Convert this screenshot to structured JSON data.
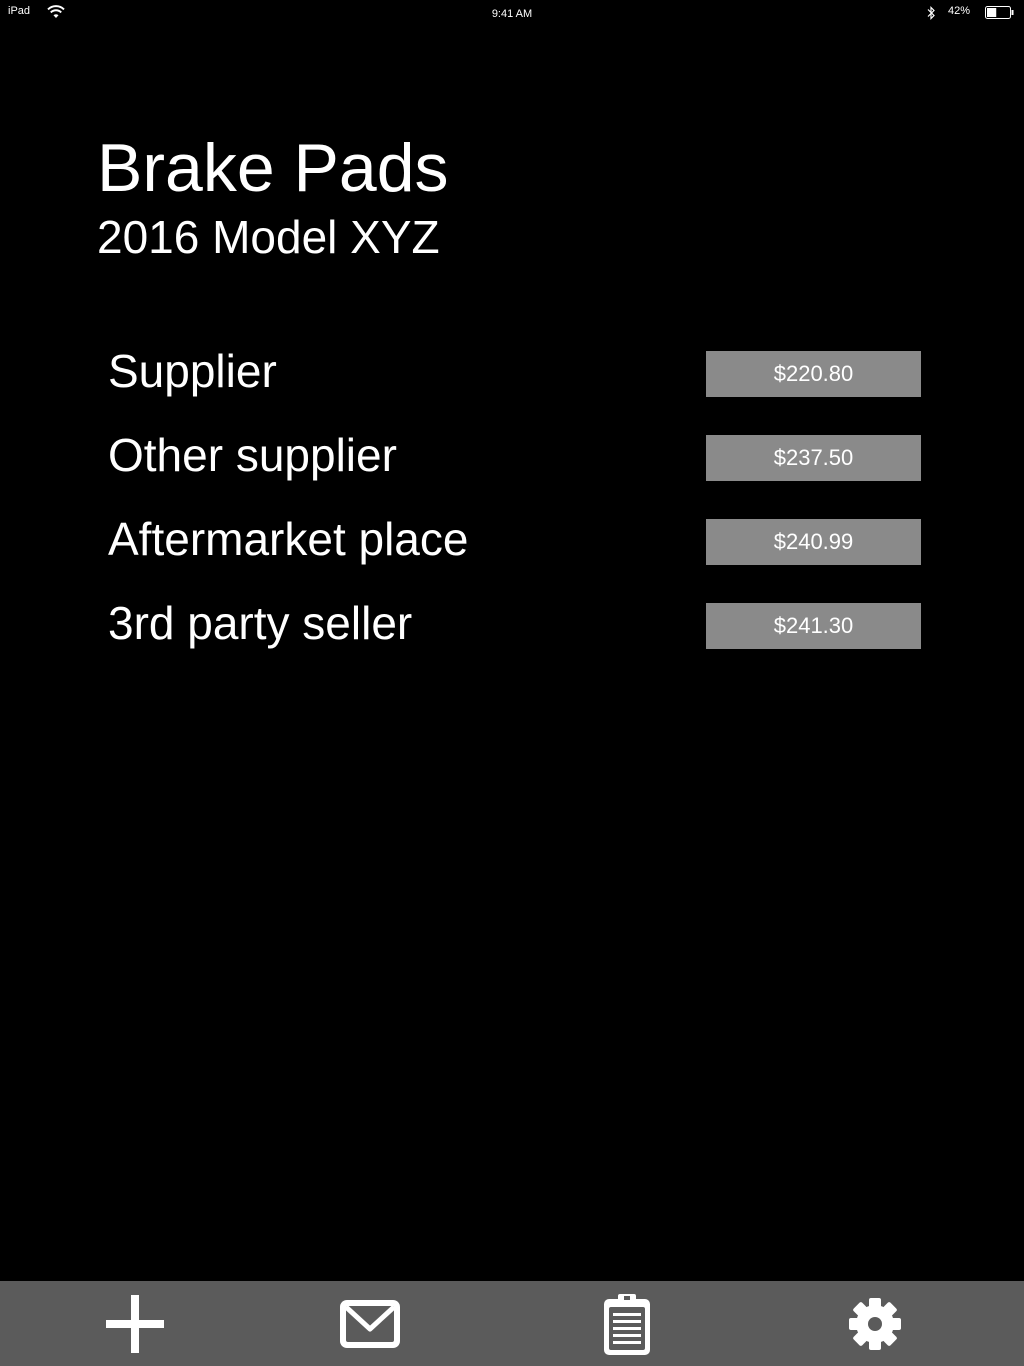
{
  "status_bar": {
    "device": "iPad",
    "time": "9:41 AM",
    "battery_percent": "42%",
    "battery_level": 0.42
  },
  "header": {
    "title": "Brake Pads",
    "subtitle": "2016 Model XYZ"
  },
  "suppliers": [
    {
      "name": "Supplier",
      "price": "$220.80"
    },
    {
      "name": "Other supplier",
      "price": "$237.50"
    },
    {
      "name": "Aftermarket place",
      "price": "$240.99"
    },
    {
      "name": "3rd party seller",
      "price": "$241.30"
    }
  ],
  "toolbar": {
    "items": [
      {
        "icon": "plus-icon"
      },
      {
        "icon": "mail-icon"
      },
      {
        "icon": "clipboard-icon"
      },
      {
        "icon": "gear-icon"
      }
    ]
  },
  "colors": {
    "background": "#000000",
    "price_button": "#8a8a8a",
    "toolbar": "#5b5b5b",
    "text": "#ffffff"
  }
}
